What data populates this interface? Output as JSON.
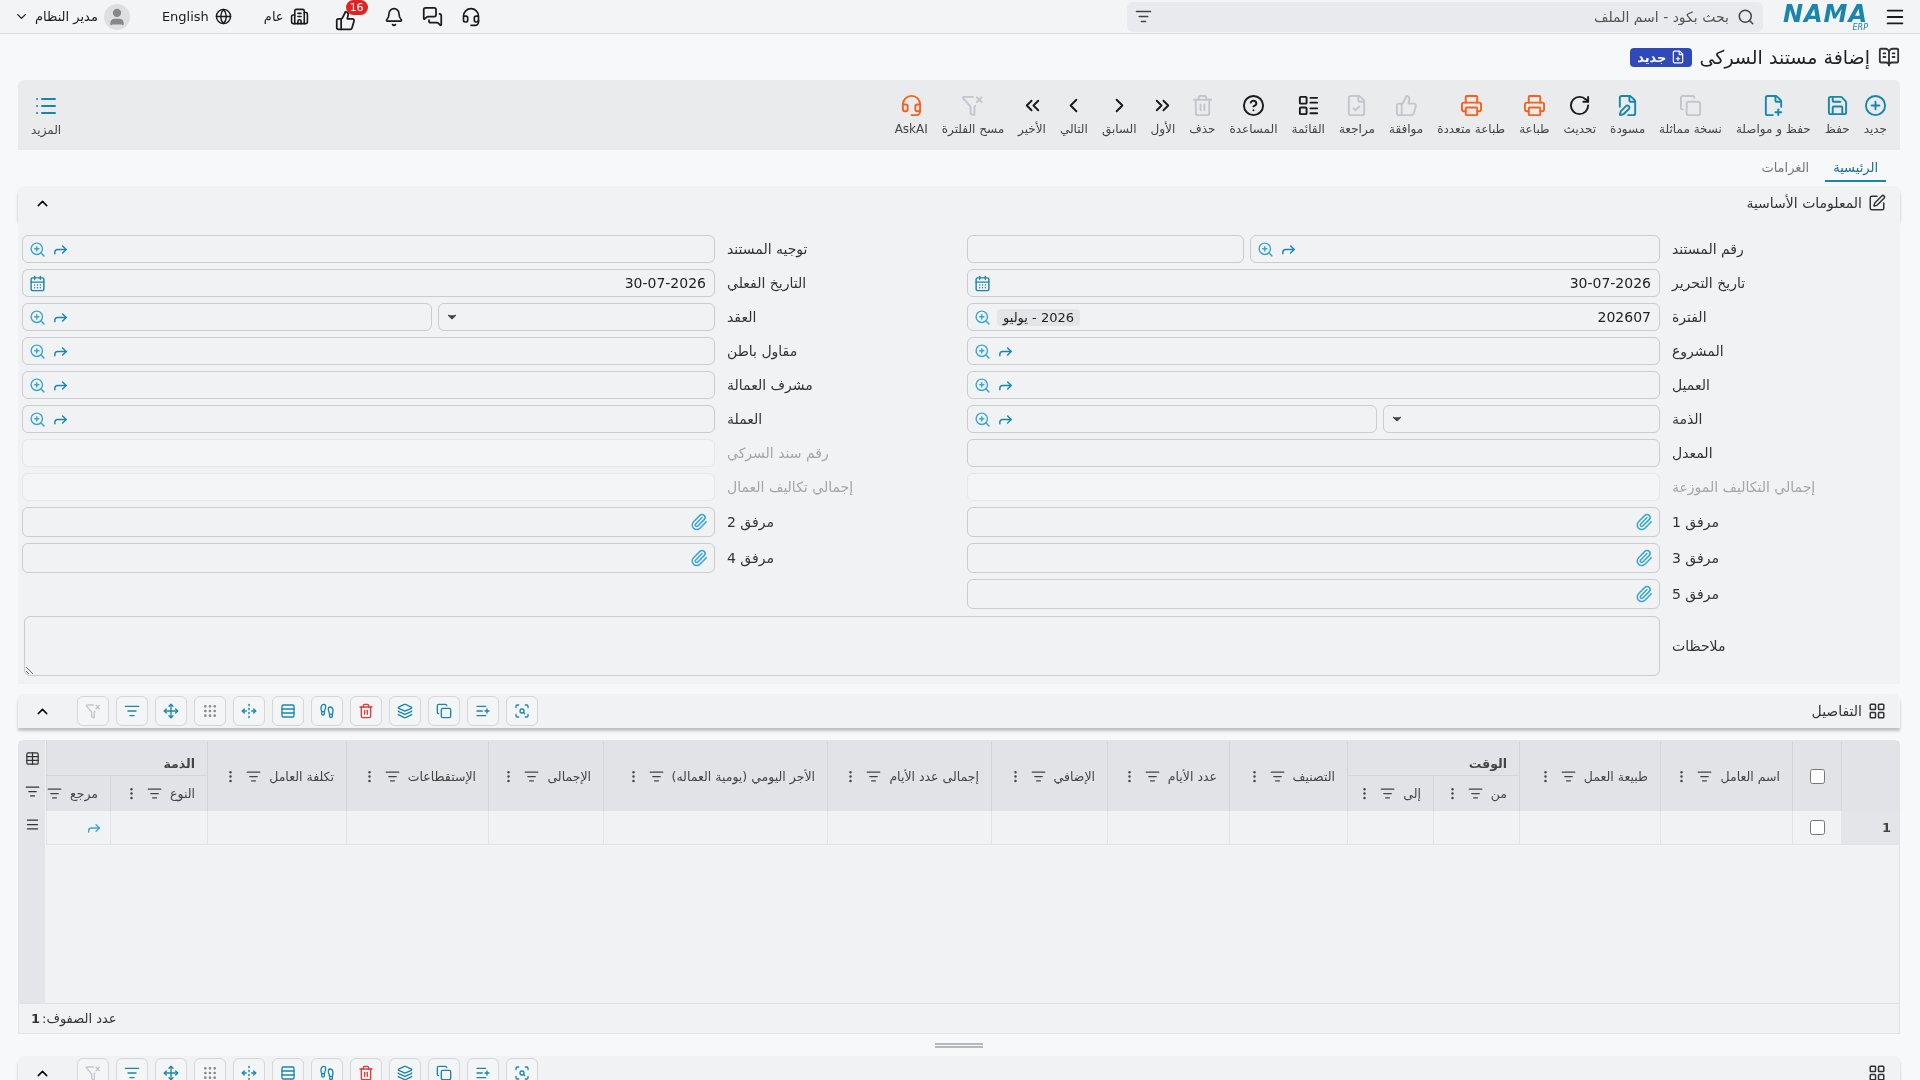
{
  "topbar": {
    "logo": {
      "name": "NAMA",
      "sub": "ERP"
    },
    "search": {
      "placeholder": "بحث بكود - اسم الملف"
    },
    "notifications": {
      "count": "16"
    },
    "branch": "عام",
    "language": "English",
    "user": "مدير النظام"
  },
  "page": {
    "title": "إضافة مستند السركى",
    "status": "جديد"
  },
  "toolbar": [
    {
      "kind": "new",
      "label": "جديد",
      "disabled": false
    },
    {
      "kind": "save",
      "label": "حفظ",
      "disabled": false
    },
    {
      "kind": "save_continue",
      "label": "حفظ و مواصلة",
      "disabled": false
    },
    {
      "kind": "duplicate",
      "label": "نسخة مماثلة",
      "disabled": true
    },
    {
      "kind": "draft",
      "label": "مسودة",
      "disabled": false
    },
    {
      "kind": "refresh",
      "label": "تحديث",
      "disabled": false
    },
    {
      "kind": "print",
      "label": "طباعة",
      "disabled": false
    },
    {
      "kind": "multi_print",
      "label": "طباعة متعددة",
      "disabled": false
    },
    {
      "kind": "approve",
      "label": "موافقة",
      "disabled": true
    },
    {
      "kind": "review",
      "label": "مراجعة",
      "disabled": true
    },
    {
      "kind": "list",
      "label": "القائمة",
      "disabled": false
    },
    {
      "kind": "help",
      "label": "المساعدة",
      "disabled": false
    },
    {
      "kind": "delete",
      "label": "حذف",
      "disabled": true
    },
    {
      "kind": "first",
      "label": "الأول",
      "disabled": false
    },
    {
      "kind": "previous",
      "label": "السابق",
      "disabled": false
    },
    {
      "kind": "next",
      "label": "التالي",
      "disabled": false
    },
    {
      "kind": "last",
      "label": "الأخير",
      "disabled": false
    },
    {
      "kind": "clear_filter",
      "label": "مسح الفلترة",
      "disabled": true
    },
    {
      "kind": "ask_ai",
      "label": "AskAI",
      "disabled": false
    }
  ],
  "more": {
    "label": "المزيد"
  },
  "tabs": [
    {
      "label": "الرئيسية",
      "selected": true
    },
    {
      "label": "الغرامات",
      "selected": false
    }
  ],
  "basic_info": {
    "title": "المعلومات الأساسية",
    "expanded": true,
    "columns": [
      [
        {
          "label": "رقم المستند",
          "kind": "code",
          "disabled": false
        },
        {
          "label": "تاريخ التحرير",
          "kind": "date",
          "value": "30-07-2026",
          "disabled": false
        },
        {
          "label": "الفترة",
          "kind": "period",
          "value": "202607",
          "chip": "2026 - يوليو",
          "disabled": false
        },
        {
          "label": "المشروع",
          "kind": "lookup",
          "disabled": false
        },
        {
          "label": "العميل",
          "kind": "lookup",
          "disabled": false
        },
        {
          "label": "الذمة",
          "kind": "select_lookup",
          "disabled": false
        },
        {
          "label": "المعدل",
          "kind": "plain",
          "disabled": false
        },
        {
          "label": "إجمالي التكاليف الموزعة",
          "kind": "plain",
          "disabled": true
        },
        {
          "label": "مرفق 1",
          "kind": "attachment",
          "disabled": false
        },
        {
          "label": "مرفق 3",
          "kind": "attachment",
          "disabled": false
        },
        {
          "label": "مرفق 5",
          "kind": "attachment",
          "disabled": false
        }
      ],
      [
        {
          "label": "توجيه المستند",
          "kind": "lookup",
          "disabled": false
        },
        {
          "label": "التاريخ الفعلي",
          "kind": "date",
          "value": "30-07-2026",
          "disabled": false
        },
        {
          "label": "العقد",
          "kind": "select_lookup",
          "disabled": false
        },
        {
          "label": "مقاول باطن",
          "kind": "lookup",
          "disabled": false
        },
        {
          "label": "مشرف العمالة",
          "kind": "lookup",
          "disabled": false
        },
        {
          "label": "العملة",
          "kind": "lookup",
          "disabled": false
        },
        {
          "label": "رقم سند السركي",
          "kind": "plain",
          "disabled": true
        },
        {
          "label": "إجمالي تكاليف العمال",
          "kind": "plain",
          "disabled": true
        },
        {
          "label": "مرفق 2",
          "kind": "attachment",
          "disabled": false
        },
        {
          "label": "مرفق 4",
          "kind": "attachment",
          "disabled": false
        }
      ]
    ],
    "notes": {
      "label": "ملاحظات"
    }
  },
  "details": {
    "title": "التفاصيل",
    "expanded": true,
    "tools": [
      {
        "kind": "search_list",
        "disabled": false
      },
      {
        "kind": "add_row",
        "disabled": false
      },
      {
        "kind": "copy",
        "disabled": false
      },
      {
        "kind": "layers",
        "disabled": false
      },
      {
        "kind": "delete",
        "disabled": false
      },
      {
        "kind": "run",
        "disabled": false
      },
      {
        "kind": "rows",
        "disabled": false
      },
      {
        "kind": "fit",
        "disabled": false
      },
      {
        "kind": "grip",
        "disabled": false
      },
      {
        "kind": "move",
        "disabled": false
      },
      {
        "kind": "filter",
        "disabled": false
      },
      {
        "kind": "clear_filter",
        "disabled": true
      }
    ],
    "select_all": {
      "checked": false
    },
    "columns": [
      {
        "label": "اسم العامل",
        "kind": "text"
      },
      {
        "label": "طبيعة العمل",
        "kind": "text"
      },
      {
        "group": "الوقت",
        "children": [
          {
            "label": "من",
            "kind": "text"
          },
          {
            "label": "إلى",
            "kind": "text"
          }
        ]
      },
      {
        "label": "التصنيف",
        "kind": "text"
      },
      {
        "label": "عدد الأيام",
        "kind": "text"
      },
      {
        "label": "الإضافي",
        "kind": "text"
      },
      {
        "label": "إجمالى عدد الأيام",
        "kind": "text"
      },
      {
        "label": "الأجر اليومي (يومية العماله)",
        "kind": "text"
      },
      {
        "label": "الإجمالى",
        "kind": "text"
      },
      {
        "label": "الإستقطاعات",
        "kind": "text"
      },
      {
        "label": "تكلفة العامل",
        "kind": "text"
      },
      {
        "group": "الذمة",
        "children": [
          {
            "label": "النوع",
            "kind": "text"
          },
          {
            "label": "مرجع",
            "kind": "reference"
          }
        ]
      }
    ],
    "rows": [
      {
        "number": "1",
        "checked": false
      }
    ],
    "row_count_label": "عدد الصفوف:",
    "row_count": "1"
  }
}
